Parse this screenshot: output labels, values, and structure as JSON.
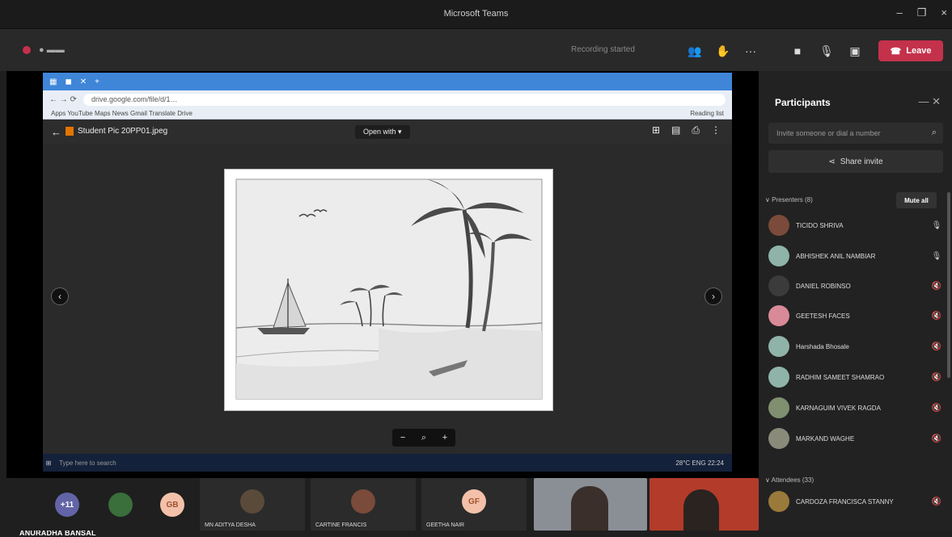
{
  "window": {
    "title": "Microsoft Teams",
    "minimize": "–",
    "maximize": "❐",
    "close": "×"
  },
  "meeting": {
    "timer": "●  ▬▬",
    "record_hint": "Recording started",
    "more": "···",
    "leave_label": "Leave"
  },
  "browser": {
    "tabs": [
      "▦",
      "◼",
      "✕",
      "+"
    ],
    "url": "drive.google.com/file/d/1…",
    "bookmarks": "Apps   YouTube   Maps   News   Gmail   Translate   Drive",
    "reading": "Reading list"
  },
  "drive": {
    "filename": "Student Pic 20PP01.jpeg",
    "open_with": "Open with ▾",
    "zoom_minus": "−",
    "zoom_search": "⌕",
    "zoom_plus": "+"
  },
  "taskbar": {
    "search": "Type here to search",
    "time": "28°C  ENG  22:24"
  },
  "presenter": "ANURADHA BANSAL",
  "gallery": [
    {
      "initials": "+11",
      "color": "#6264a7",
      "name": ""
    },
    {
      "initials": "",
      "color": "#3a6e3a",
      "name": ""
    },
    {
      "initials": "GB",
      "color": "#f3c1aa",
      "name": ""
    },
    {
      "initials": "",
      "color": "#3a3a3a",
      "name": "MN ADITYA DESHA"
    },
    {
      "initials": "",
      "color": "#3a3a3a",
      "name": "CARTINE FRANCIS"
    },
    {
      "initials": "GF",
      "color": "#f3c1aa",
      "name": "GEETHA NAIR"
    }
  ],
  "participants": {
    "title": "Participants",
    "invite_placeholder": "Invite someone or dial a number",
    "share_invite": "Share invite",
    "presenters": "∨ Presenters (8)",
    "mute_all": "Mute all",
    "attendees": "∨ Attendees (33)",
    "list": [
      {
        "name": "TICIDO SHRIVA",
        "color": "#7a4a3a",
        "mic": "🎙"
      },
      {
        "name": "ABHISHEK ANIL NAMBIAR",
        "color": "#8fb3a8",
        "mic": "🎙"
      },
      {
        "name": "DANIEL ROBINSO",
        "color": "#3b3b3b",
        "mic": "🔇"
      },
      {
        "name": "GEETESH FACES",
        "color": "#d98a98",
        "mic": "🔇"
      },
      {
        "name": "Harshada Bhosale",
        "color": "#8fb3a8",
        "mic": "🔇"
      },
      {
        "name": "RADHIM SAMEET SHAMRAO",
        "color": "#8fb3a8",
        "mic": "🔇"
      },
      {
        "name": "KARNAGUIM VIVEK RAGDA",
        "color": "#7f8f6f",
        "mic": "🔇"
      },
      {
        "name": "MARKAND WAGHE",
        "color": "#8a8a7a",
        "mic": "🔇"
      },
      {
        "name": "CARDOZA FRANCISCA STANNY",
        "color": "#9a7a3a",
        "mic": "🔇"
      }
    ]
  }
}
